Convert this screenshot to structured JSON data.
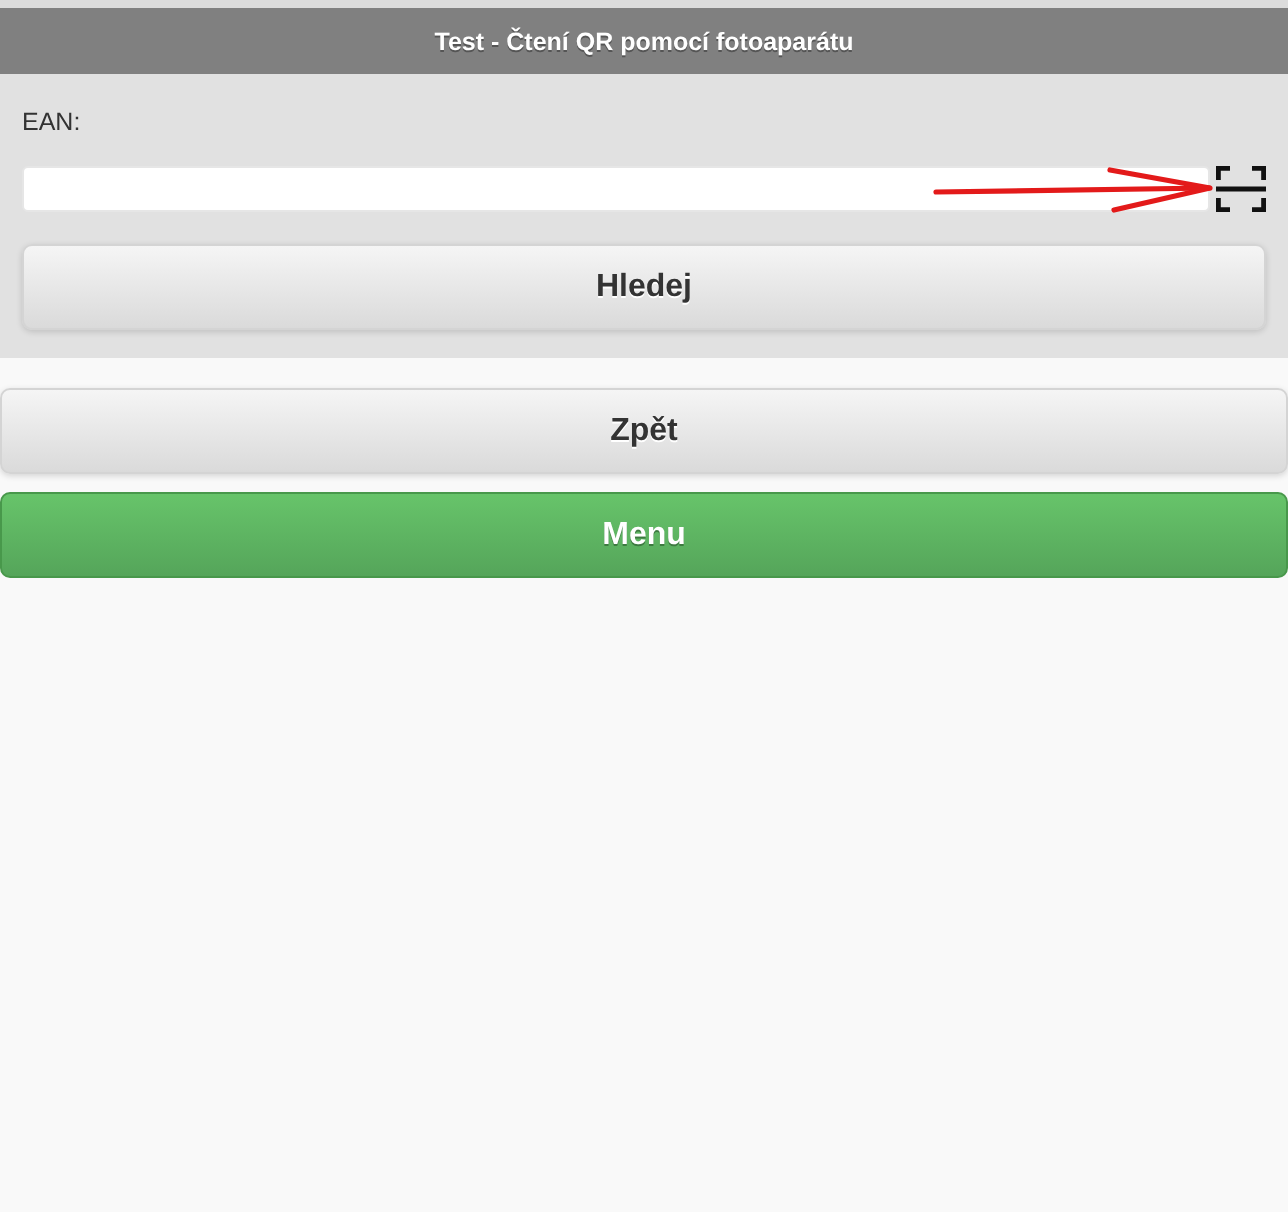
{
  "header": {
    "title": "Test - Čtení QR pomocí fotoaparátu"
  },
  "form": {
    "ean_label": "EAN:",
    "search_button": "Hledej"
  },
  "buttons": [
    {
      "label": "Zpět",
      "kind": "default"
    },
    {
      "label": "Menu",
      "kind": "primary"
    }
  ]
}
